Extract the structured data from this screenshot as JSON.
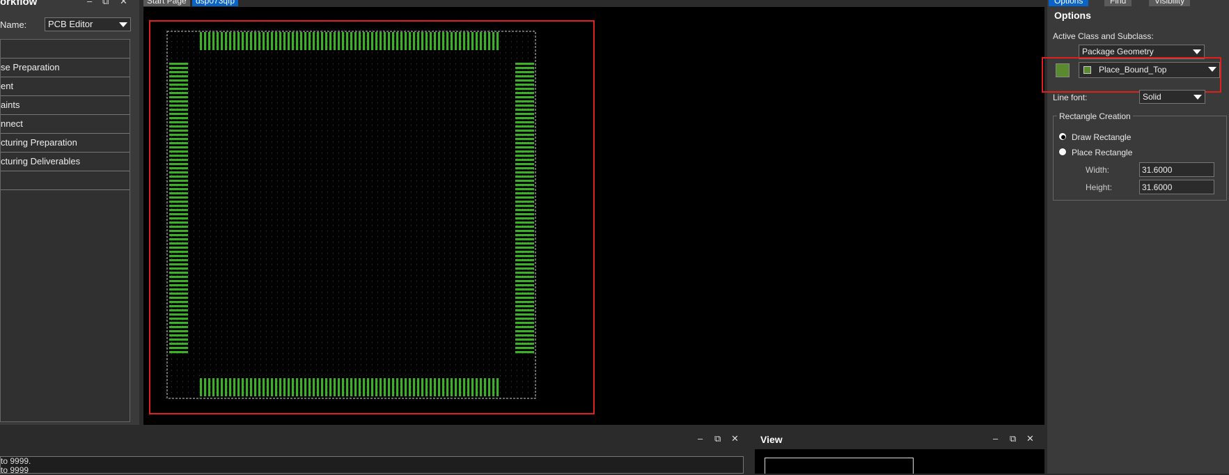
{
  "workflow": {
    "title": "orkflow",
    "minimize": "–",
    "restore": "⧉",
    "close": "✕",
    "name_label": "Name:",
    "name_value": "PCB Editor",
    "items": [
      "",
      "se Preparation",
      "ent",
      "aints",
      "nnect",
      "cturing Preparation",
      "cturing Deliverables",
      ""
    ]
  },
  "tabs": [
    {
      "label": "Start Page",
      "active": false
    },
    {
      "label": "dsp073qfp",
      "active": true
    }
  ],
  "right_tabs": [
    "Options",
    "Find",
    "Visibility"
  ],
  "options": {
    "title": "Options",
    "active_class_label": "Active Class and Subclass:",
    "class_value": "Package Geometry",
    "subclass_value": "Place_Bound_Top",
    "swatch_color": "#5a8a2e",
    "line_font_label": "Line font:",
    "line_font_value": "Solid",
    "rect_group_label": "Rectangle Creation",
    "draw_rect_label": "Draw Rectangle",
    "place_rect_label": "Place Rectangle",
    "draw_rect_checked": true,
    "width_label": "Width:",
    "width_value": "31.6000",
    "height_label": "Height:",
    "height_value": "31.6000"
  },
  "bottom": {
    "console_lines": [
      "to 9999.",
      "to 9999"
    ],
    "minimize": "–",
    "restore": "⧉",
    "close": "✕"
  },
  "view_panel": {
    "title": "View",
    "minimize": "–",
    "restore": "⧉",
    "close": "✕"
  },
  "colors": {
    "pad_green": "#3fae2a",
    "highlight_red": "#e0201c",
    "accent_blue": "#0a64c8"
  }
}
